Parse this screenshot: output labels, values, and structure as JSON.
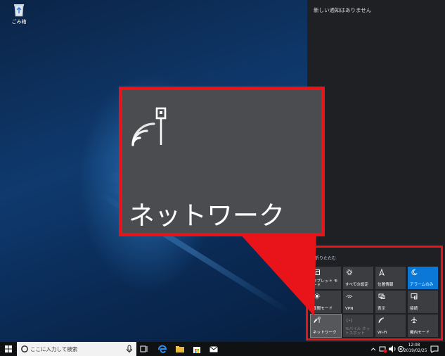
{
  "desktop": {
    "recycle_bin_label": "ごみ箱"
  },
  "action_center": {
    "no_notifications": "新しい通知はありません",
    "collapse_label": "折りたたむ",
    "tiles": [
      {
        "label": "タブレット モード",
        "icon": "tablet-mode-icon",
        "state": "off"
      },
      {
        "label": "すべての設定",
        "icon": "settings-gear-icon",
        "state": "off"
      },
      {
        "label": "位置情報",
        "icon": "location-icon",
        "state": "off"
      },
      {
        "label": "アラームのみ",
        "icon": "moon-icon",
        "state": "on"
      },
      {
        "label": "夜間モード",
        "icon": "brightness-icon",
        "state": "off"
      },
      {
        "label": "VPN",
        "icon": "vpn-icon",
        "state": "off"
      },
      {
        "label": "表示",
        "icon": "project-display-icon",
        "state": "off"
      },
      {
        "label": "接続",
        "icon": "connect-icon",
        "state": "off"
      },
      {
        "label": "ネットワーク",
        "icon": "network-icon",
        "state": "selected"
      },
      {
        "label": "モバイル ホットスポット",
        "icon": "mobile-hotspot-icon",
        "state": "disabled"
      },
      {
        "label": "Wi-Fi",
        "icon": "wifi-icon",
        "state": "off"
      },
      {
        "label": "機内モード",
        "icon": "airplane-icon",
        "state": "off"
      }
    ]
  },
  "zoom_callout": {
    "label": "ネットワーク",
    "icon": "network-icon"
  },
  "taskbar": {
    "search_placeholder": "ここに入力して検索",
    "time": "12:08",
    "date": "2019/02/25"
  },
  "colors": {
    "highlight_red": "#e8141a",
    "accent_blue": "#0b78d7",
    "tile_gray": "#3c3d40",
    "panel_bg": "#1f2023"
  }
}
